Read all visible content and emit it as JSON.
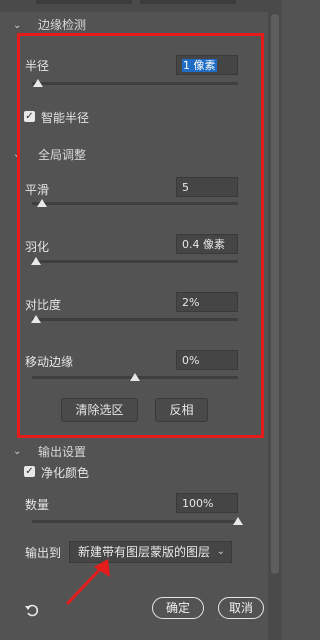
{
  "sections": {
    "edge_detection": "边缘检测",
    "global_adjust": "全局调整",
    "output_settings": "输出设置"
  },
  "radius": {
    "label": "半径",
    "value": "1 像素",
    "slider": 0.03
  },
  "smart_radius": {
    "label": "智能半径",
    "checked": true
  },
  "smooth": {
    "label": "平滑",
    "value": "5",
    "slider": 0.05
  },
  "feather": {
    "label": "羽化",
    "value": "0.4 像素",
    "slider": 0.02
  },
  "contrast": {
    "label": "对比度",
    "value": "2%",
    "slider": 0.02
  },
  "shift_edge": {
    "label": "移动边缘",
    "value": "0%",
    "slider": 0.5
  },
  "buttons": {
    "clear": "清除选区",
    "invert": "反相"
  },
  "decontaminate": {
    "label": "净化颜色",
    "checked": true
  },
  "amount": {
    "label": "数量",
    "value": "100%",
    "slider": 1.0
  },
  "output": {
    "label": "输出到",
    "value": "新建带有图层蒙版的图层"
  },
  "footer": {
    "ok": "确定",
    "cancel": "取消"
  },
  "colors": {
    "annotation": "#e51c1c",
    "selection": "#1e6cc4"
  },
  "icons": {
    "reset": "reset-icon",
    "chevron": "chevron-down-icon",
    "check": "checkmark-icon",
    "arrow": "annotation-arrow-icon"
  }
}
